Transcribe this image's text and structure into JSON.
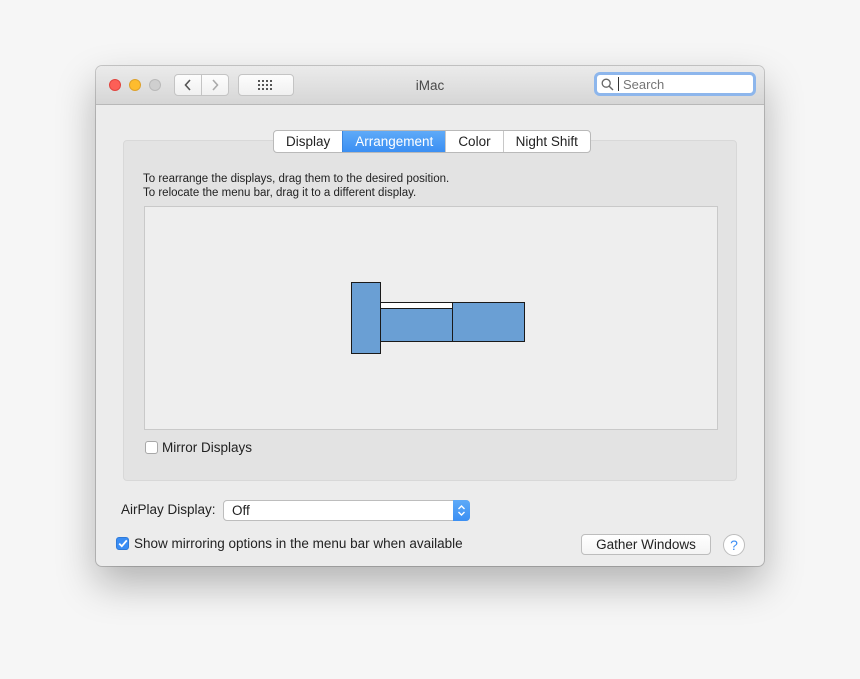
{
  "window": {
    "title": "iMac",
    "search_placeholder": "Search"
  },
  "toolbar": {
    "back_icon": "chevron-left-icon",
    "forward_icon": "chevron-right-icon",
    "grid_icon": "grid-dots-icon"
  },
  "tabs": [
    {
      "label": "Display",
      "active": false
    },
    {
      "label": "Arrangement",
      "active": true
    },
    {
      "label": "Color",
      "active": false
    },
    {
      "label": "Night Shift",
      "active": false
    }
  ],
  "arrangement": {
    "instruction_line1": "To rearrange the displays, drag them to the desired position.",
    "instruction_line2": "To relocate the menu bar, drag it to a different display.",
    "display_color": "#6a9fd4",
    "mirror_label": "Mirror Displays",
    "mirror_checked": false
  },
  "airplay": {
    "label": "AirPlay Display:",
    "value": "Off"
  },
  "mirroring_option": {
    "label": "Show mirroring options in the menu bar when available",
    "checked": true
  },
  "buttons": {
    "gather_windows": "Gather Windows",
    "help": "?"
  },
  "colors": {
    "accent": "#3a8df4",
    "close": "#fd5f57",
    "minimize": "#febc2e"
  }
}
